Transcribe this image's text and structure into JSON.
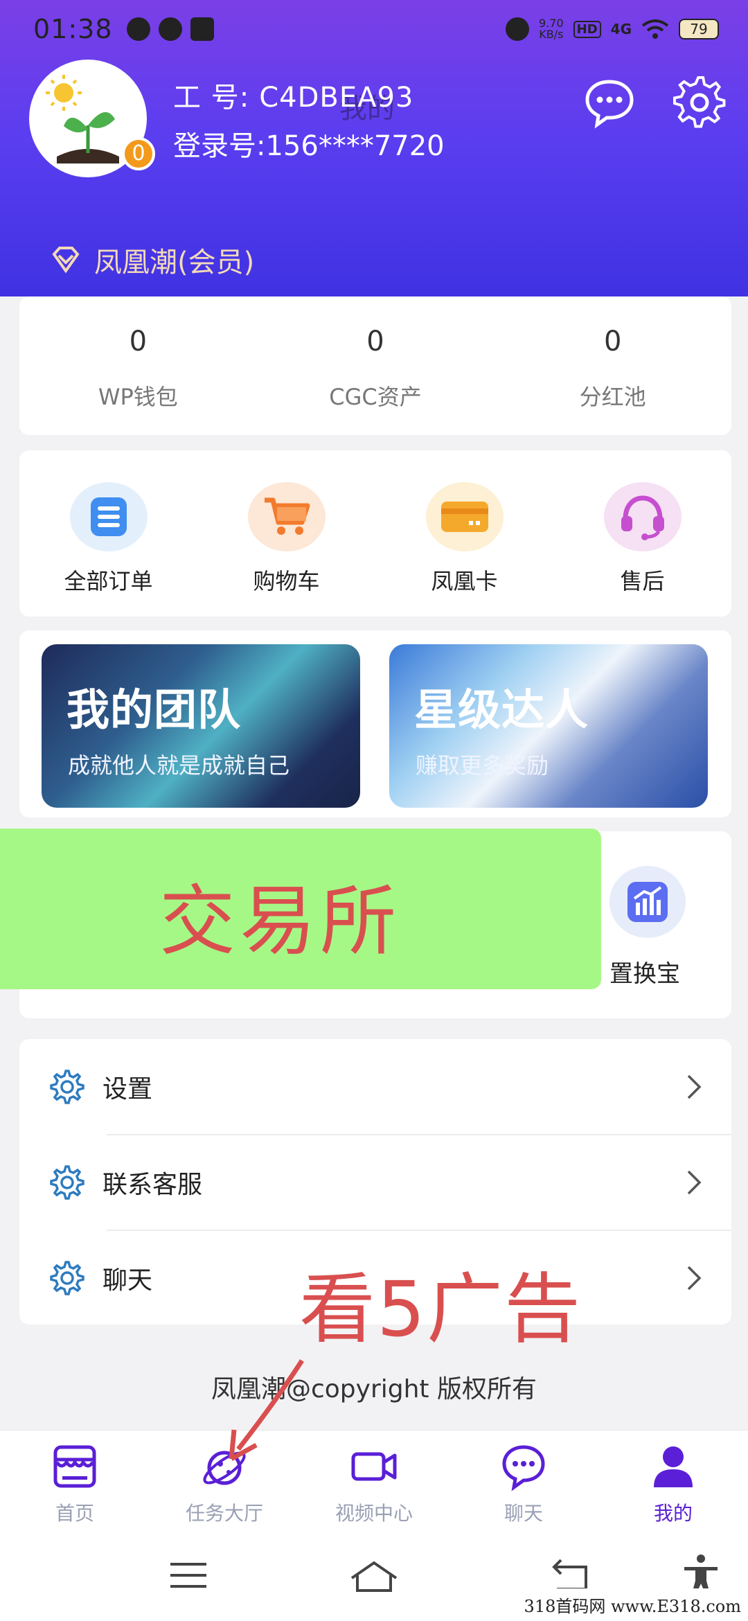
{
  "status": {
    "time": "01:38",
    "speed_value": "9.70",
    "speed_unit": "KB/s",
    "hd": "HD",
    "network": "4G",
    "battery": "79"
  },
  "profile": {
    "page_title": "我的",
    "uid_label": "工    号:",
    "uid_value": "C4DBEA93",
    "login_label": "登录号:",
    "login_value": "156****7720",
    "badge": "0",
    "membership": "凤凰潮(会员)"
  },
  "stats": [
    {
      "value": "0",
      "label": "WP钱包"
    },
    {
      "value": "0",
      "label": "CGC资产"
    },
    {
      "value": "0",
      "label": "分红池"
    }
  ],
  "orders": [
    {
      "label": "全部订单",
      "icon": "list-icon"
    },
    {
      "label": "购物车",
      "icon": "cart-icon"
    },
    {
      "label": "凤凰卡",
      "icon": "card-icon"
    },
    {
      "label": "售后",
      "icon": "headset-icon"
    }
  ],
  "banners": [
    {
      "title": "我的团队",
      "subtitle": "成就他人就是成就自己"
    },
    {
      "title": "星级达人",
      "subtitle": "赚取更多奖励"
    }
  ],
  "exchange": {
    "overlay_text": "交易所",
    "item_label": "置换宝"
  },
  "menu": [
    {
      "label": "设置"
    },
    {
      "label": "联系客服"
    },
    {
      "label": "聊天"
    }
  ],
  "ad_overlay": "看5广告",
  "copyright": "凤凰潮@copyright 版权所有",
  "tabs": [
    {
      "label": "首页",
      "icon": "store-icon"
    },
    {
      "label": "任务大厅",
      "icon": "planet-icon"
    },
    {
      "label": "视频中心",
      "icon": "video-icon"
    },
    {
      "label": "聊天",
      "icon": "chat-icon"
    },
    {
      "label": "我的",
      "icon": "person-icon",
      "active": true
    }
  ],
  "watermark": "318首码网  www.E318.com",
  "colors": {
    "header_top": "#7b3fe6",
    "header_bottom": "#3f32e2",
    "active_tab": "#5a1fd6",
    "overlay_red": "#d94f4f",
    "overlay_green": "#a6f886"
  }
}
